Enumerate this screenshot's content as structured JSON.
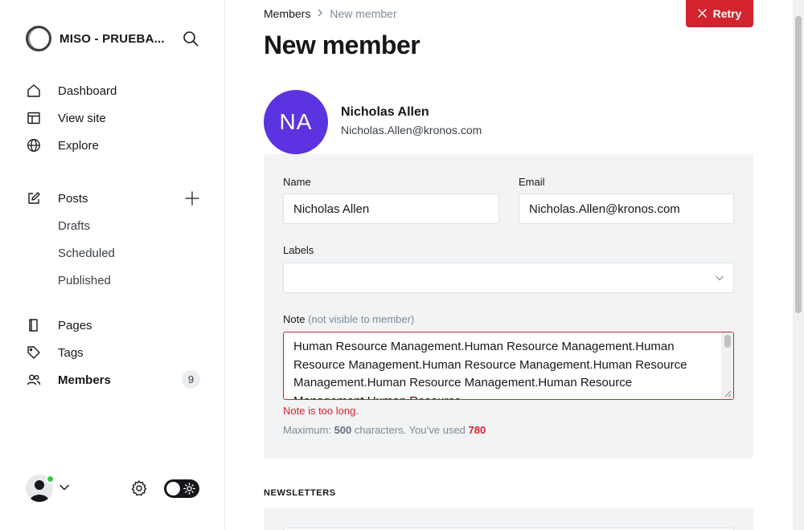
{
  "brand": {
    "name": "MISO - PRUEBA..."
  },
  "sidebar": {
    "primary": [
      {
        "label": "Dashboard",
        "icon": "home-icon"
      },
      {
        "label": "View site",
        "icon": "layout-icon"
      },
      {
        "label": "Explore",
        "icon": "globe-icon"
      }
    ],
    "posts": {
      "label": "Posts",
      "icon": "edit-icon"
    },
    "post_subitems": [
      "Drafts",
      "Scheduled",
      "Published"
    ],
    "secondary": [
      {
        "label": "Pages",
        "icon": "pages-icon"
      },
      {
        "label": "Tags",
        "icon": "tag-icon"
      },
      {
        "label": "Members",
        "icon": "members-icon",
        "badge": "9",
        "active": true
      }
    ]
  },
  "breadcrumb": {
    "parent": "Members",
    "current": "New member"
  },
  "header": {
    "title": "New member",
    "retry_label": "Retry"
  },
  "member": {
    "initials": "NA",
    "name": "Nicholas Allen",
    "email": "Nicholas.Allen@kronos.com",
    "avatar_color": "#5b33e0"
  },
  "form": {
    "name_label": "Name",
    "name_value": "Nicholas Allen",
    "email_label": "Email",
    "email_value": "Nicholas.Allen@kronos.com",
    "labels_label": "Labels",
    "labels_value": "",
    "note_label": "Note",
    "note_hint": "(not visible to member)",
    "note_value": "Human Resource Management.Human Resource Management.Human Resource Management.Human Resource Management.Human Resource Management.Human Resource Management.Human Resource Management.Human Resource",
    "note_error": "Note is too long.",
    "count_prefix": "Maximum: ",
    "count_max": "500",
    "count_middle": " characters. You’ve used ",
    "count_used": "780"
  },
  "newsletters": {
    "title": "NEWSLETTERS"
  },
  "colors": {
    "accent_error": "#d2232e",
    "status_online": "#30cf43"
  }
}
